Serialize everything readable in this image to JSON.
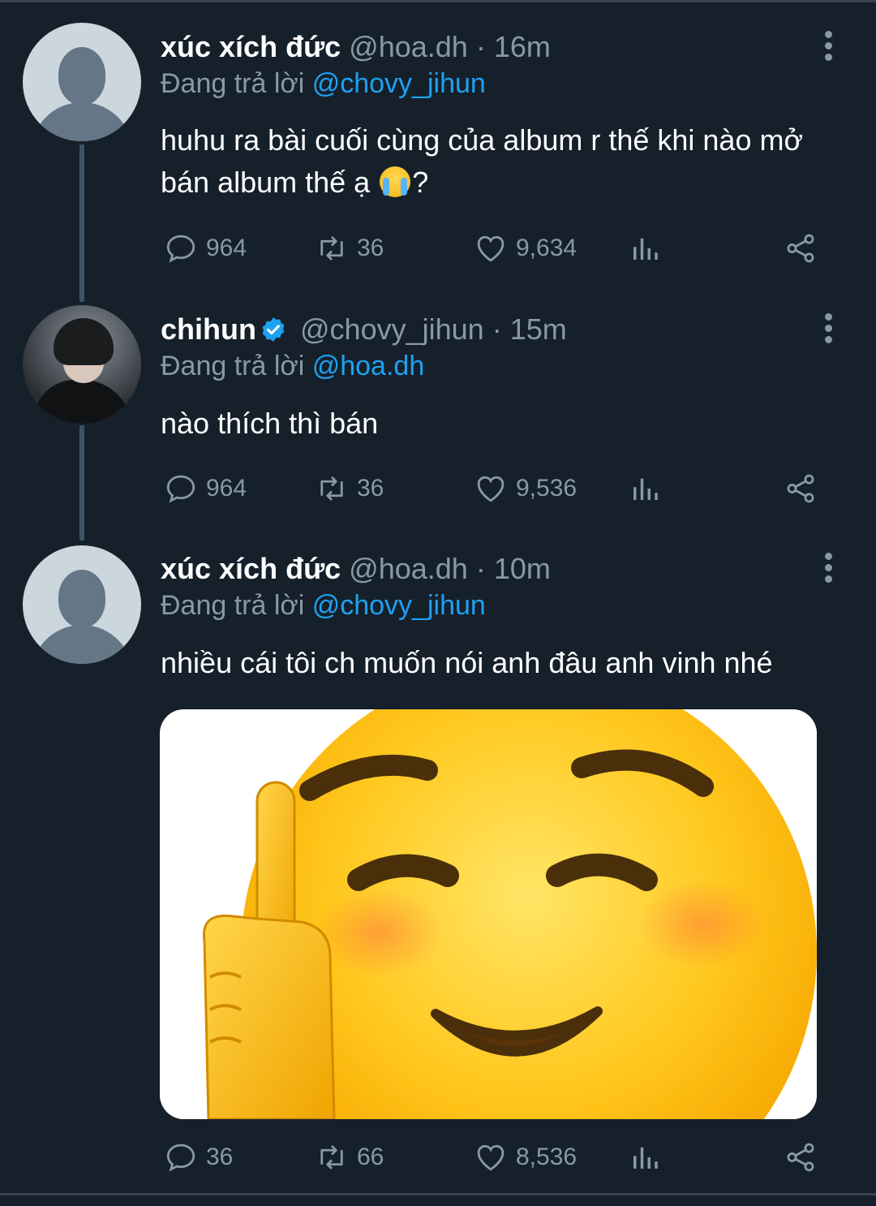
{
  "tweets": [
    {
      "display_name": "xúc xích đức",
      "handle": "@hoa.dh",
      "separator": "·",
      "time": "16m",
      "replying_prefix": "Đang trả lời",
      "replying_to": "@chovy_jihun",
      "text_before_emoji": "huhu ra bài cuối cùng của album r thế khi nào mở bán album thế ạ",
      "emoji": "loudly-crying-face",
      "text_after_emoji": "?",
      "replies": "964",
      "retweets": "36",
      "likes": "9,634"
    },
    {
      "display_name": "chihun",
      "verified": true,
      "handle": "@chovy_jihun",
      "separator": "·",
      "time": "15m",
      "replying_prefix": "Đang trả lời",
      "replying_to": "@hoa.dh",
      "text": "nào thích thì bán",
      "replies": "964",
      "retweets": "36",
      "likes": "9,536"
    },
    {
      "display_name": "xúc xích đức",
      "handle": "@hoa.dh",
      "separator": "·",
      "time": "10m",
      "replying_prefix": "Đang trả lời",
      "replying_to": "@chovy_jihun",
      "text": "nhiều cái tôi ch muốn nói anh đâu anh vinh nhé",
      "media": "smiling-emoji-middle-finger",
      "replies": "36",
      "retweets": "66",
      "likes": "8,536"
    }
  ],
  "colors": {
    "background": "#15202b",
    "secondary_text": "#8899a6",
    "accent": "#1da1f2",
    "thread_line": "#3d5466"
  }
}
